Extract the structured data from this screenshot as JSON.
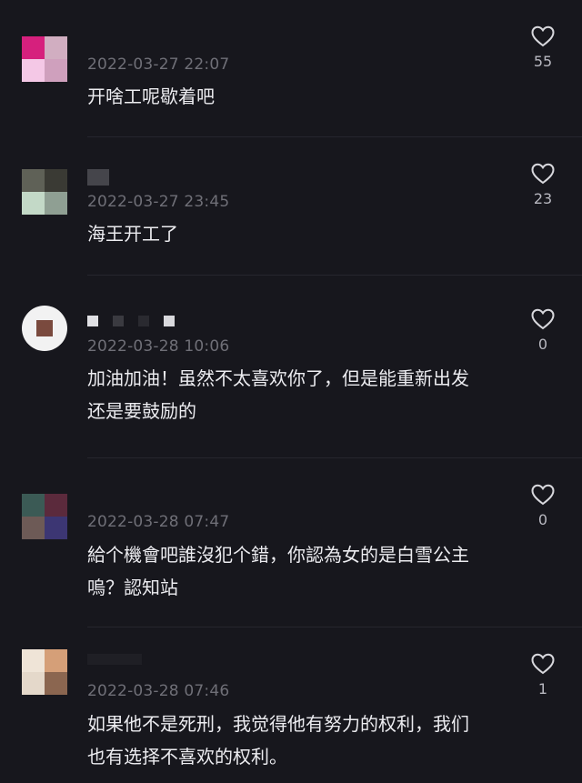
{
  "comments": [
    {
      "timestamp": "2022-03-27 22:07",
      "text": "开啥工呢歇着吧",
      "likes": "55",
      "avatar_colors": [
        "#d6207d",
        "#d1aec1",
        "#f4c8e6",
        "#cfa0bd"
      ]
    },
    {
      "timestamp": "2022-03-27 23:45",
      "text": "海王开工了",
      "likes": "23",
      "avatar_colors": [
        "#5f6157",
        "#3a3a34",
        "#c3d9c7",
        "#8f9f93"
      ]
    },
    {
      "timestamp": "2022-03-28 10:06",
      "text_line1": "加油加油！虽然不太喜欢你了，但是能重新出发",
      "text_line2": "还是要鼓励的",
      "likes": "0",
      "avatar_colors": [
        "#f2f2f2",
        "#f2f2f2",
        "#f2f2f2",
        "#f2f2f2"
      ]
    },
    {
      "timestamp": "2022-03-28 07:47",
      "text_line1": "給个機會吧誰沒犯个錯，你認為女的是白雪公主",
      "text_line2": "嗚？認知站",
      "likes": "0",
      "avatar_colors": [
        "#3b5a55",
        "#5b2a3c",
        "#6d5a56",
        "#3c3673"
      ]
    },
    {
      "timestamp": "2022-03-28 07:46",
      "text_line1": "如果他不是死刑，我觉得他有努力的权利，我们",
      "text_line2": "也有选择不喜欢的权利。",
      "likes": "1",
      "avatar_colors": [
        "#efe4d7",
        "#d59f78",
        "#e4d8ca",
        "#8b6650"
      ]
    }
  ]
}
